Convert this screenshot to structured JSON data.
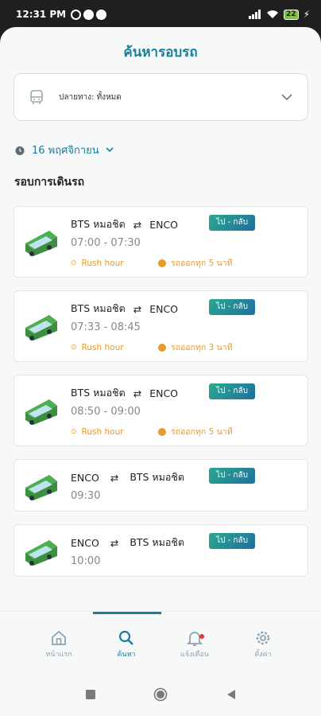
{
  "status_bar": {
    "time": "12:31 PM",
    "battery": "22"
  },
  "header": {
    "title": "ค้นหารอบรถ"
  },
  "destination": {
    "label": "ปลายทาง: ทั้งหมด"
  },
  "date": {
    "label": "16 พฤศจิกายน"
  },
  "section": {
    "title": "รอบการเดินรถ"
  },
  "trips": [
    {
      "from": "BTS หมอชิต",
      "to": "ENCO",
      "badge": "ไป - กลับ",
      "time": "07:00 - 07:30",
      "tag": "Rush hour",
      "frequency": "รถออกทุก 5 นาที"
    },
    {
      "from": "BTS หมอชิต",
      "to": "ENCO",
      "badge": "ไป - กลับ",
      "time": "07:33 - 08:45",
      "tag": "Rush hour",
      "frequency": "รถออกทุก 3 นาที"
    },
    {
      "from": "BTS หมอชิต",
      "to": "ENCO",
      "badge": "ไป - กลับ",
      "time": "08:50 - 09:00",
      "tag": "Rush hour",
      "frequency": "รถออกทุก 5 นาที"
    },
    {
      "from": "ENCO",
      "to": "BTS หมอชิต",
      "badge": "ไป - กลับ",
      "time": "09:30"
    },
    {
      "from": "ENCO",
      "to": "BTS หมอชิต",
      "badge": "ไป - กลับ",
      "time": "10:00"
    }
  ],
  "nav": {
    "home": "หน้าแรก",
    "search": "ค้นหา",
    "notifications": "แจ้งเตือน",
    "settings": "ตั้งค่า"
  },
  "colors": {
    "accent": "#1a7f9c",
    "warning": "#e7992d",
    "bus_green": "#4caf50"
  }
}
